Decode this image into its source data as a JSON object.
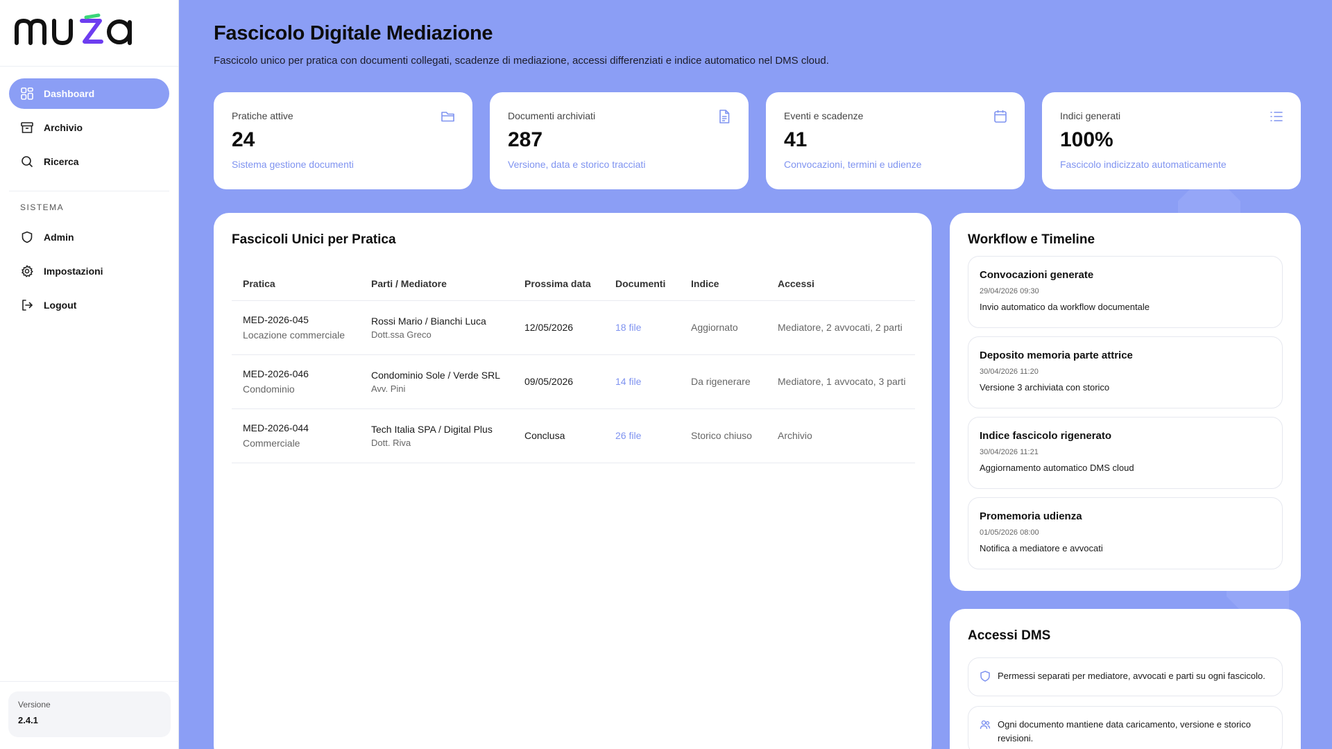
{
  "brand": {
    "logo_text": "muza",
    "accent": "#8b9ef5",
    "link_color": "#7f93f0"
  },
  "sidebar": {
    "items": [
      {
        "label": "Dashboard",
        "icon": "dashboard-icon",
        "active": true
      },
      {
        "label": "Archivio",
        "icon": "archive-icon"
      },
      {
        "label": "Ricerca",
        "icon": "search-icon"
      }
    ],
    "section_label": "SISTEMA",
    "system_items": [
      {
        "label": "Admin",
        "icon": "shield-icon"
      },
      {
        "label": "Impostazioni",
        "icon": "gear-icon"
      },
      {
        "label": "Logout",
        "icon": "logout-icon"
      }
    ],
    "version_label": "Versione",
    "version_value": "2.4.1"
  },
  "header": {
    "title": "Fascicolo Digitale Mediazione",
    "subtitle": "Fascicolo unico per pratica con documenti collegati, scadenze di mediazione, accessi differenziati e indice automatico nel DMS cloud."
  },
  "stats": [
    {
      "label": "Pratiche attive",
      "value": "24",
      "note": "Sistema gestione documenti",
      "icon": "folder-icon"
    },
    {
      "label": "Documenti archiviati",
      "value": "287",
      "note": "Versione, data e storico tracciati",
      "icon": "document-icon"
    },
    {
      "label": "Eventi e scadenze",
      "value": "41",
      "note": "Convocazioni, termini e udienze",
      "icon": "calendar-icon"
    },
    {
      "label": "Indici generati",
      "value": "100%",
      "note": "Fascicolo indicizzato automaticamente",
      "icon": "list-icon"
    }
  ],
  "fascicoli": {
    "title": "Fascicoli Unici per Pratica",
    "columns": [
      "Pratica",
      "Parti / Mediatore",
      "Prossima data",
      "Documenti",
      "Indice",
      "Accessi"
    ],
    "rows": [
      {
        "id": "MED-2026-045",
        "type": "Locazione commerciale",
        "parti": "Rossi Mario / Bianchi Luca",
        "mediatore": "Dott.ssa Greco",
        "data": "12/05/2026",
        "documenti": "18 file",
        "indice": "Aggiornato",
        "accessi": "Mediatore, 2 avvocati, 2 parti"
      },
      {
        "id": "MED-2026-046",
        "type": "Condominio",
        "parti": "Condominio Sole / Verde SRL",
        "mediatore": "Avv. Pini",
        "data": "09/05/2026",
        "documenti": "14 file",
        "indice": "Da rigenerare",
        "accessi": "Mediatore, 1 avvocato, 3 parti"
      },
      {
        "id": "MED-2026-044",
        "type": "Commerciale",
        "parti": "Tech Italia SPA / Digital Plus",
        "mediatore": "Dott. Riva",
        "data": "Conclusa",
        "documenti": "26 file",
        "indice": "Storico chiuso",
        "accessi": "Archivio"
      }
    ]
  },
  "workflow": {
    "title": "Workflow e Timeline",
    "items": [
      {
        "title": "Convocazioni generate",
        "time": "29/04/2026 09:30",
        "desc": "Invio automatico da workflow documentale"
      },
      {
        "title": "Deposito memoria parte attrice",
        "time": "30/04/2026 11:20",
        "desc": "Versione 3 archiviata con storico"
      },
      {
        "title": "Indice fascicolo rigenerato",
        "time": "30/04/2026 11:21",
        "desc": "Aggiornamento automatico DMS cloud"
      },
      {
        "title": "Promemoria udienza",
        "time": "01/05/2026 08:00",
        "desc": "Notifica a mediatore e avvocati"
      }
    ]
  },
  "accessi": {
    "title": "Accessi DMS",
    "items": [
      {
        "text": "Permessi separati per mediatore, avvocati e parti su ogni fascicolo.",
        "icon": "shield-icon"
      },
      {
        "text": "Ogni documento mantiene data caricamento, versione e storico revisioni.",
        "icon": "users-icon"
      }
    ]
  }
}
